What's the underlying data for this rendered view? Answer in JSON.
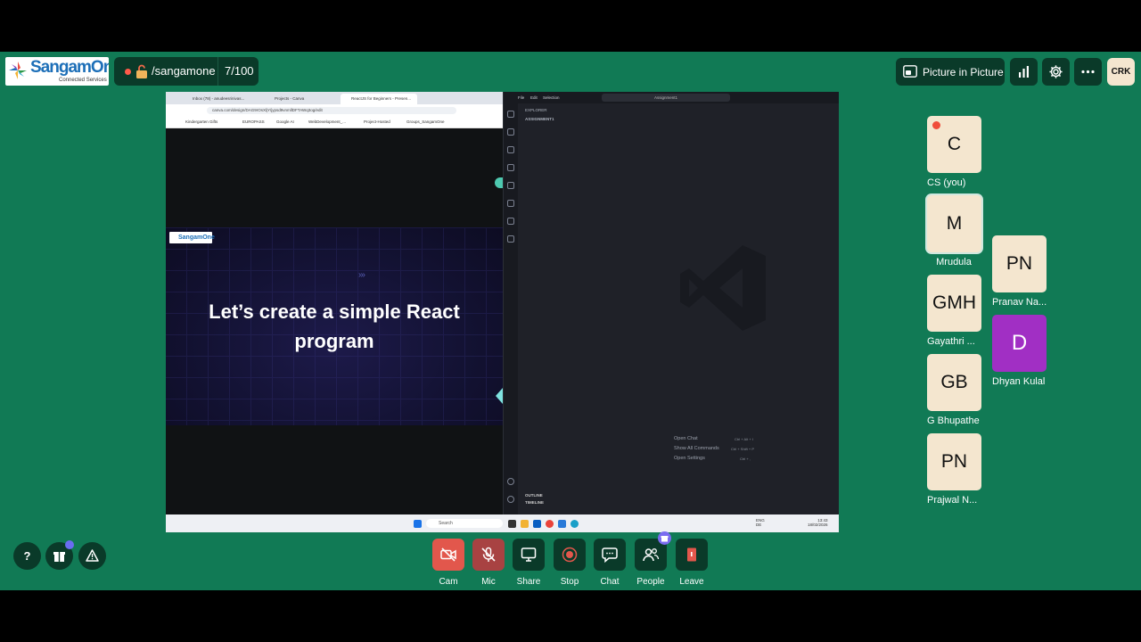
{
  "header": {
    "logo_text": "SangamOne",
    "logo_subtext": "Connected Services",
    "room_name": "/sangamone",
    "participant_count": "7/100",
    "pip_label": "Picture in Picture",
    "user_initials": "CRK"
  },
  "screen": {
    "browser_tabs": [
      "Inbox (78) - anudeesrinivas...",
      "Projects - Canva",
      "ReactJS for Beginners - Presen..."
    ],
    "url": "canva.com/design/DAG9rOsXljY/jypsd9vnmllDFTAWq3og/edit",
    "bookmarks": [
      "Kindergarten Gifts",
      "EUROPASS",
      "Google AI",
      "WebDevelopment_...",
      "Project-Hosted",
      "Groups_SangamOne"
    ],
    "slide_title_line1": "Let’s create a simple React",
    "slide_title_line2": "program",
    "slide_logo": "SangamOne",
    "vscode_menu": [
      "File",
      "Edit",
      "Selection"
    ],
    "vscode_search": "Assignment1",
    "explorer_title": "EXPLORER",
    "explorer_folder": "ASSIGNMENT1",
    "hints": [
      {
        "label": "Open Chat",
        "keys": "Ctrl + Alt + I"
      },
      {
        "label": "Show All Commands",
        "keys": "Ctrl + Shift + P"
      },
      {
        "label": "Open Settings",
        "keys": "Ctrl + ,"
      }
    ],
    "outline_label": "OUTLINE",
    "timeline_label": "TIMELINE",
    "taskbar_search": "Search",
    "taskbar_lang": "ENG",
    "taskbar_region": "DE",
    "taskbar_time": "13:43",
    "taskbar_date": "18/02/2026"
  },
  "participants": [
    {
      "initials": "C",
      "name": "CS (you)"
    },
    {
      "initials": "M",
      "name": "Mrudula"
    },
    {
      "initials": "GMH",
      "name": "Gayathri ..."
    },
    {
      "initials": "GB",
      "name": "G Bhupathe"
    },
    {
      "initials": "PN",
      "name": "Prajwal N..."
    },
    {
      "initials": "PN",
      "name": "Pranav Na..."
    },
    {
      "initials": "D",
      "name": "Dhyan Kulal"
    }
  ],
  "controls": {
    "cam": "Cam",
    "mic": "Mic",
    "share": "Share",
    "stop": "Stop",
    "chat": "Chat",
    "people": "People",
    "leave": "Leave"
  },
  "help_label": "?",
  "colors": {
    "stage_bg": "#117a55",
    "button_bg": "#0a3a29",
    "danger": "#e2574c",
    "mic_muted": "#a84242",
    "leave": "#e2574c",
    "tile_bg": "#f4e6cf",
    "tile_purple": "#a12fc4"
  }
}
